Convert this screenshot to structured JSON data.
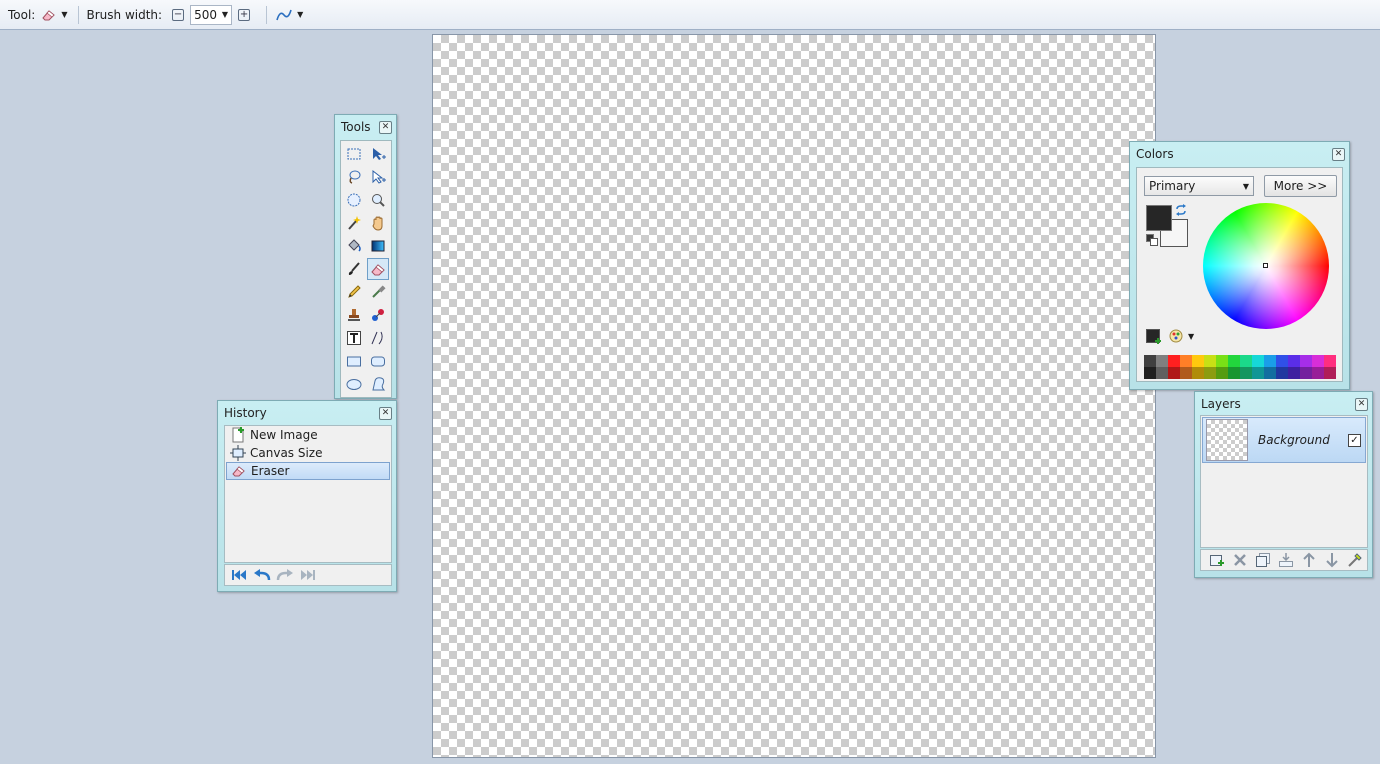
{
  "toolbar": {
    "tool_label": "Tool:",
    "tool_icon": "eraser-icon",
    "brush_width_label": "Brush width:",
    "brush_width_value": "500",
    "antialias_icon": "antialiasing-icon"
  },
  "tools_panel": {
    "title": "Tools",
    "tools": [
      "rectangle-select-icon",
      "move-selection-icon",
      "lasso-select-icon",
      "move-selected-icon",
      "ellipse-select-icon",
      "zoom-icon",
      "magic-wand-icon",
      "pan-icon",
      "paint-bucket-icon",
      "gradient-icon",
      "paintbrush-icon",
      "eraser-icon",
      "pencil-icon",
      "color-picker-icon",
      "clone-stamp-icon",
      "recolor-icon",
      "text-icon",
      "line-curve-icon",
      "rectangle-icon",
      "rounded-rectangle-icon",
      "ellipse-icon",
      "freeform-shape-icon"
    ],
    "active_tool": "eraser-icon"
  },
  "history_panel": {
    "title": "History",
    "items": [
      {
        "label": "New Image",
        "icon": "new-image-icon"
      },
      {
        "label": "Canvas Size",
        "icon": "canvas-size-icon"
      },
      {
        "label": "Eraser",
        "icon": "eraser-icon"
      }
    ],
    "selected_index": 2
  },
  "colors_panel": {
    "title": "Colors",
    "mode": "Primary",
    "more_label": "More >>",
    "primary_color": "#262626",
    "secondary_color": "#f6f6f6",
    "palette_top": [
      "#404040",
      "#808080",
      "#ff2020",
      "#ff7f27",
      "#ffc90e",
      "#c8e015",
      "#79e016",
      "#22d63d",
      "#1bd98a",
      "#16d8d8",
      "#1a9ee8",
      "#3050e8",
      "#5a2ee8",
      "#a62ee8",
      "#d82ed8",
      "#ff2e7f"
    ],
    "palette_bottom": [
      "#202020",
      "#606060",
      "#b01818",
      "#b05a1c",
      "#b08c0a",
      "#8c9c10",
      "#559c10",
      "#189630",
      "#149660",
      "#109696",
      "#126ea0",
      "#2038a0",
      "#3e20a0",
      "#74209e",
      "#981e98",
      "#b01e58"
    ]
  },
  "layers_panel": {
    "title": "Layers",
    "layers": [
      {
        "name": "Background",
        "visible": true
      }
    ]
  },
  "colors": {
    "panel_bg": "#b8e2e8",
    "workspace_bg": "#c6d1df"
  }
}
